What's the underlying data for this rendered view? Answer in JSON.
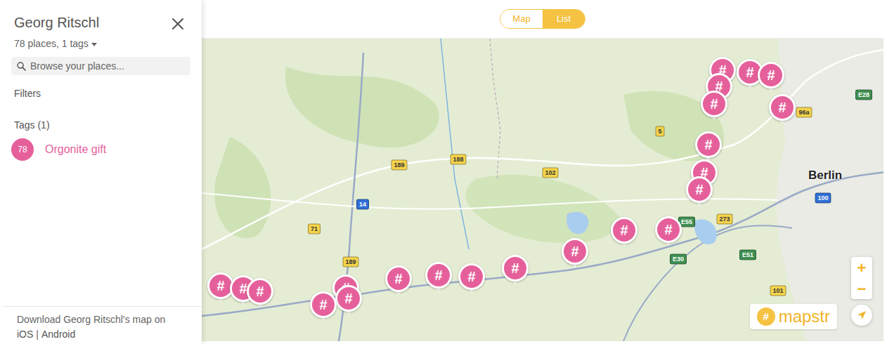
{
  "sidebar": {
    "title": "Georg Ritschl",
    "subtitle": "78 places, 1 tags",
    "search": {
      "placeholder": "Browse your places..."
    },
    "filters_label": "Filters",
    "tags_heading": "Tags (1)",
    "tags": [
      {
        "count": "78",
        "label": "Orgonite gift",
        "color": "#e5609b"
      }
    ],
    "footer": {
      "text": "Download Georg Ritschl's map on",
      "links": [
        "iOS",
        "|",
        "Android"
      ]
    }
  },
  "view_toggle": [
    {
      "label": "Map",
      "selected": false
    },
    {
      "label": "List",
      "selected": true
    }
  ],
  "map": {
    "city": "Berlin",
    "pins": [
      {
        "label": "#"
      },
      {
        "label": "#"
      },
      {
        "label": "#"
      },
      {
        "label": "#"
      },
      {
        "label": "#"
      },
      {
        "label": "#"
      },
      {
        "label": "#"
      },
      {
        "label": "#"
      },
      {
        "label": "#"
      },
      {
        "label": "#"
      },
      {
        "label": "#"
      },
      {
        "label": "#"
      },
      {
        "label": "#"
      },
      {
        "label": "#"
      },
      {
        "label": "#"
      },
      {
        "label": "#"
      },
      {
        "label": "#"
      },
      {
        "label": "#"
      },
      {
        "label": "#"
      },
      {
        "label": "#"
      },
      {
        "label": "#"
      },
      {
        "label": "#"
      }
    ],
    "road_shields": [
      {
        "label": "E28",
        "color": "#3f8f52"
      },
      {
        "label": "96a",
        "color": "#f5d34c"
      },
      {
        "label": "5",
        "color": "#f5d34c"
      },
      {
        "label": "189",
        "color": "#f5d34c"
      },
      {
        "label": "188",
        "color": "#f5d34c"
      },
      {
        "label": "102",
        "color": "#f5d34c"
      },
      {
        "label": "14",
        "color": "#2f6fd6"
      },
      {
        "label": "71",
        "color": "#f5d34c"
      },
      {
        "label": "189",
        "color": "#f5d34c"
      },
      {
        "label": "E55",
        "color": "#3f8f52"
      },
      {
        "label": "273",
        "color": "#f5d34c"
      },
      {
        "label": "E30",
        "color": "#3f8f52"
      },
      {
        "label": "E51",
        "color": "#3f8f52"
      },
      {
        "label": "100",
        "color": "#2f6fd6"
      },
      {
        "label": "101",
        "color": "#f5d34c"
      }
    ],
    "zoom": [
      "+",
      "−"
    ],
    "logo": {
      "mark": "#",
      "text": "mapstr"
    }
  }
}
